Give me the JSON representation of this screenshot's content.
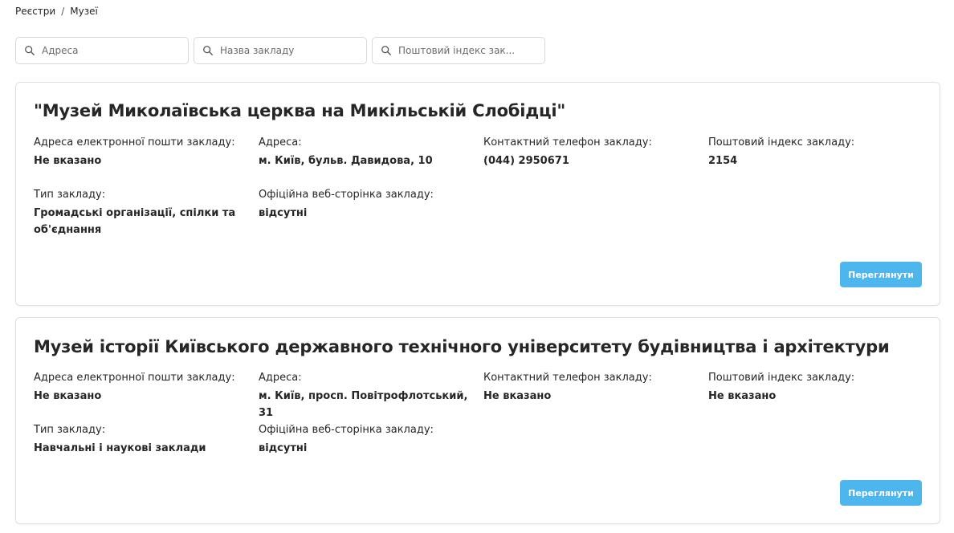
{
  "breadcrumb": {
    "root": "Реєстри",
    "separator": "/",
    "current": "Музеї"
  },
  "filters": {
    "address_placeholder": "Адреса",
    "name_placeholder": "Назва закладу",
    "postal_placeholder": "Поштовий індекс зак..."
  },
  "labels": {
    "email": "Адреса електронної пошти закладу:",
    "address": "Адреса:",
    "phone": "Контактний телефон закладу:",
    "postal": "Поштовий індекс закладу:",
    "type": "Тип закладу:",
    "website": "Офіційна веб-сторінка закладу:",
    "view_button": "Переглянути"
  },
  "cards": [
    {
      "title": "\"Музей Миколаївська церква на Микільській Слобідці\"",
      "email": "Не вказано",
      "address": "м. Київ, бульв. Давидова, 10",
      "phone": "(044) 2950671",
      "postal": "2154",
      "type": "Громадські організації, спілки та об'єднання",
      "website": "відсутні"
    },
    {
      "title": "Музей історії Київського державного технічного університету будівництва і архітектури",
      "email": "Не вказано",
      "address": "м. Київ, просп. Повітрофлотський, 31",
      "phone": "Не вказано",
      "postal": "Не вказано",
      "type": "Навчальні і наукові заклади",
      "website": "відсутні"
    }
  ],
  "colors": {
    "accent": "#4db6ec",
    "text": "#262626",
    "border": "#e0e0e0"
  }
}
